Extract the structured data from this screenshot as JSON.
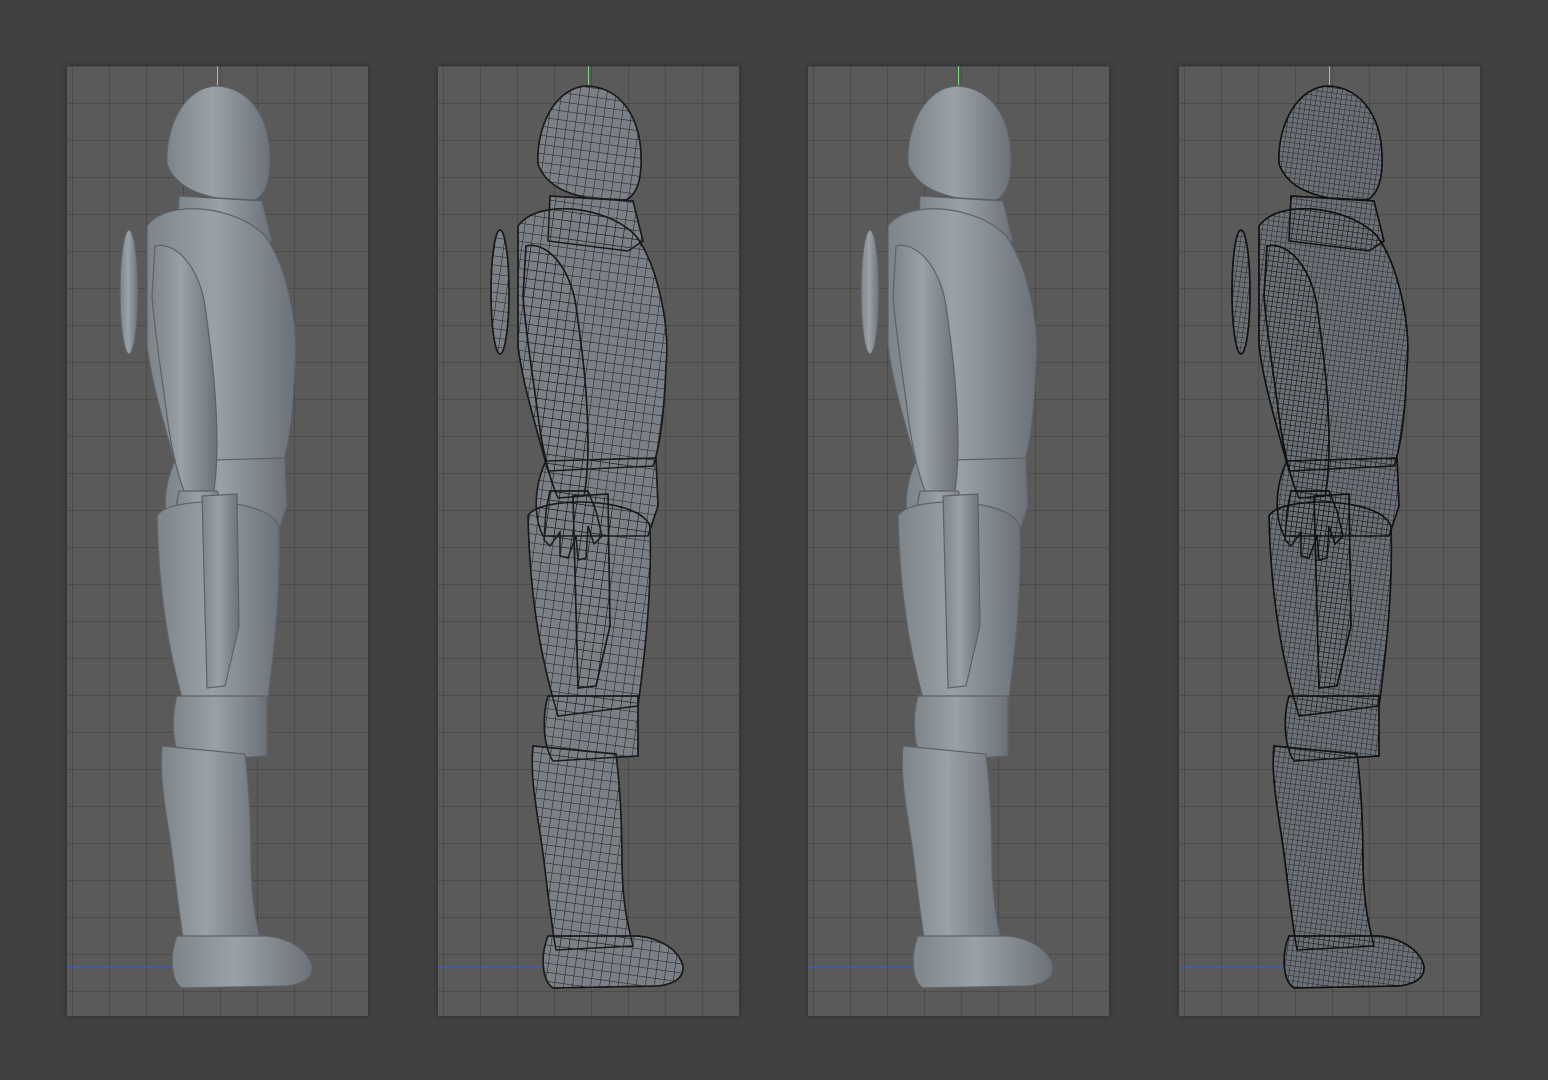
{
  "colors": {
    "background": "#414141",
    "viewport": "#5a5a5a",
    "grid": "#4d4d4d",
    "axis_y": "#7fd37f",
    "axis_x": "#3a5bd0",
    "model_shaded": "#8a9096",
    "model_shaded_dark": "#6e747a",
    "model_wire_fill": "#7a8086",
    "wire_light": "#1c1c1c",
    "wire_dense": "#111111"
  },
  "viewports": [
    {
      "view": "side",
      "shading": "smooth-shaded",
      "mesh": "low-poly",
      "icon": "axis-gizmo-icon"
    },
    {
      "view": "side",
      "shading": "wireframe-on-shaded",
      "mesh": "low-poly",
      "icon": "axis-gizmo-icon"
    },
    {
      "view": "side",
      "shading": "smooth-shaded",
      "mesh": "subdivided",
      "icon": "axis-gizmo-icon"
    },
    {
      "view": "side",
      "shading": "wireframe-on-shaded",
      "mesh": "subdivided",
      "icon": "axis-gizmo-icon"
    }
  ]
}
